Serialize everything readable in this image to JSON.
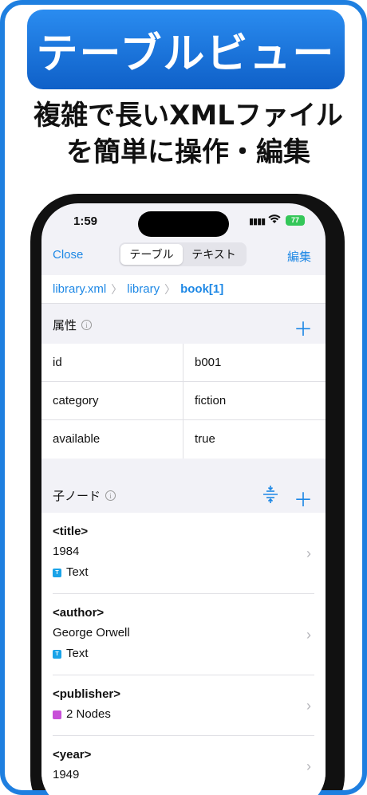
{
  "promo": {
    "banner": "テーブルビュー",
    "headline_line1": "複雑で長いXMLファイル",
    "headline_line2": "を簡単に操作・編集"
  },
  "status_bar": {
    "time": "1:59",
    "battery": "77"
  },
  "navbar": {
    "close": "Close",
    "edit": "編集",
    "segments": [
      "テーブル",
      "テキスト"
    ],
    "selected_segment": "テーブル"
  },
  "breadcrumb": [
    "library.xml",
    "library",
    "book[1]"
  ],
  "attributes": {
    "title": "属性",
    "rows": [
      {
        "key": "id",
        "value": "b001"
      },
      {
        "key": "category",
        "value": "fiction"
      },
      {
        "key": "available",
        "value": "true"
      }
    ]
  },
  "children": {
    "title": "子ノード",
    "items": [
      {
        "tag": "<title>",
        "value": "1984",
        "meta": "Text",
        "meta_type": "text"
      },
      {
        "tag": "<author>",
        "value": "George Orwell",
        "meta": "Text",
        "meta_type": "text"
      },
      {
        "tag": "<publisher>",
        "value": "",
        "meta": "2 Nodes",
        "meta_type": "nodes"
      },
      {
        "tag": "<year>",
        "value": "1949",
        "meta": "",
        "meta_type": ""
      }
    ]
  },
  "colors": {
    "accent": "#1e88e5",
    "frame": "#1e7fe0",
    "text_badge": "#1aa3e8",
    "nodes_badge": "#c84fd8",
    "battery": "#34c759"
  }
}
